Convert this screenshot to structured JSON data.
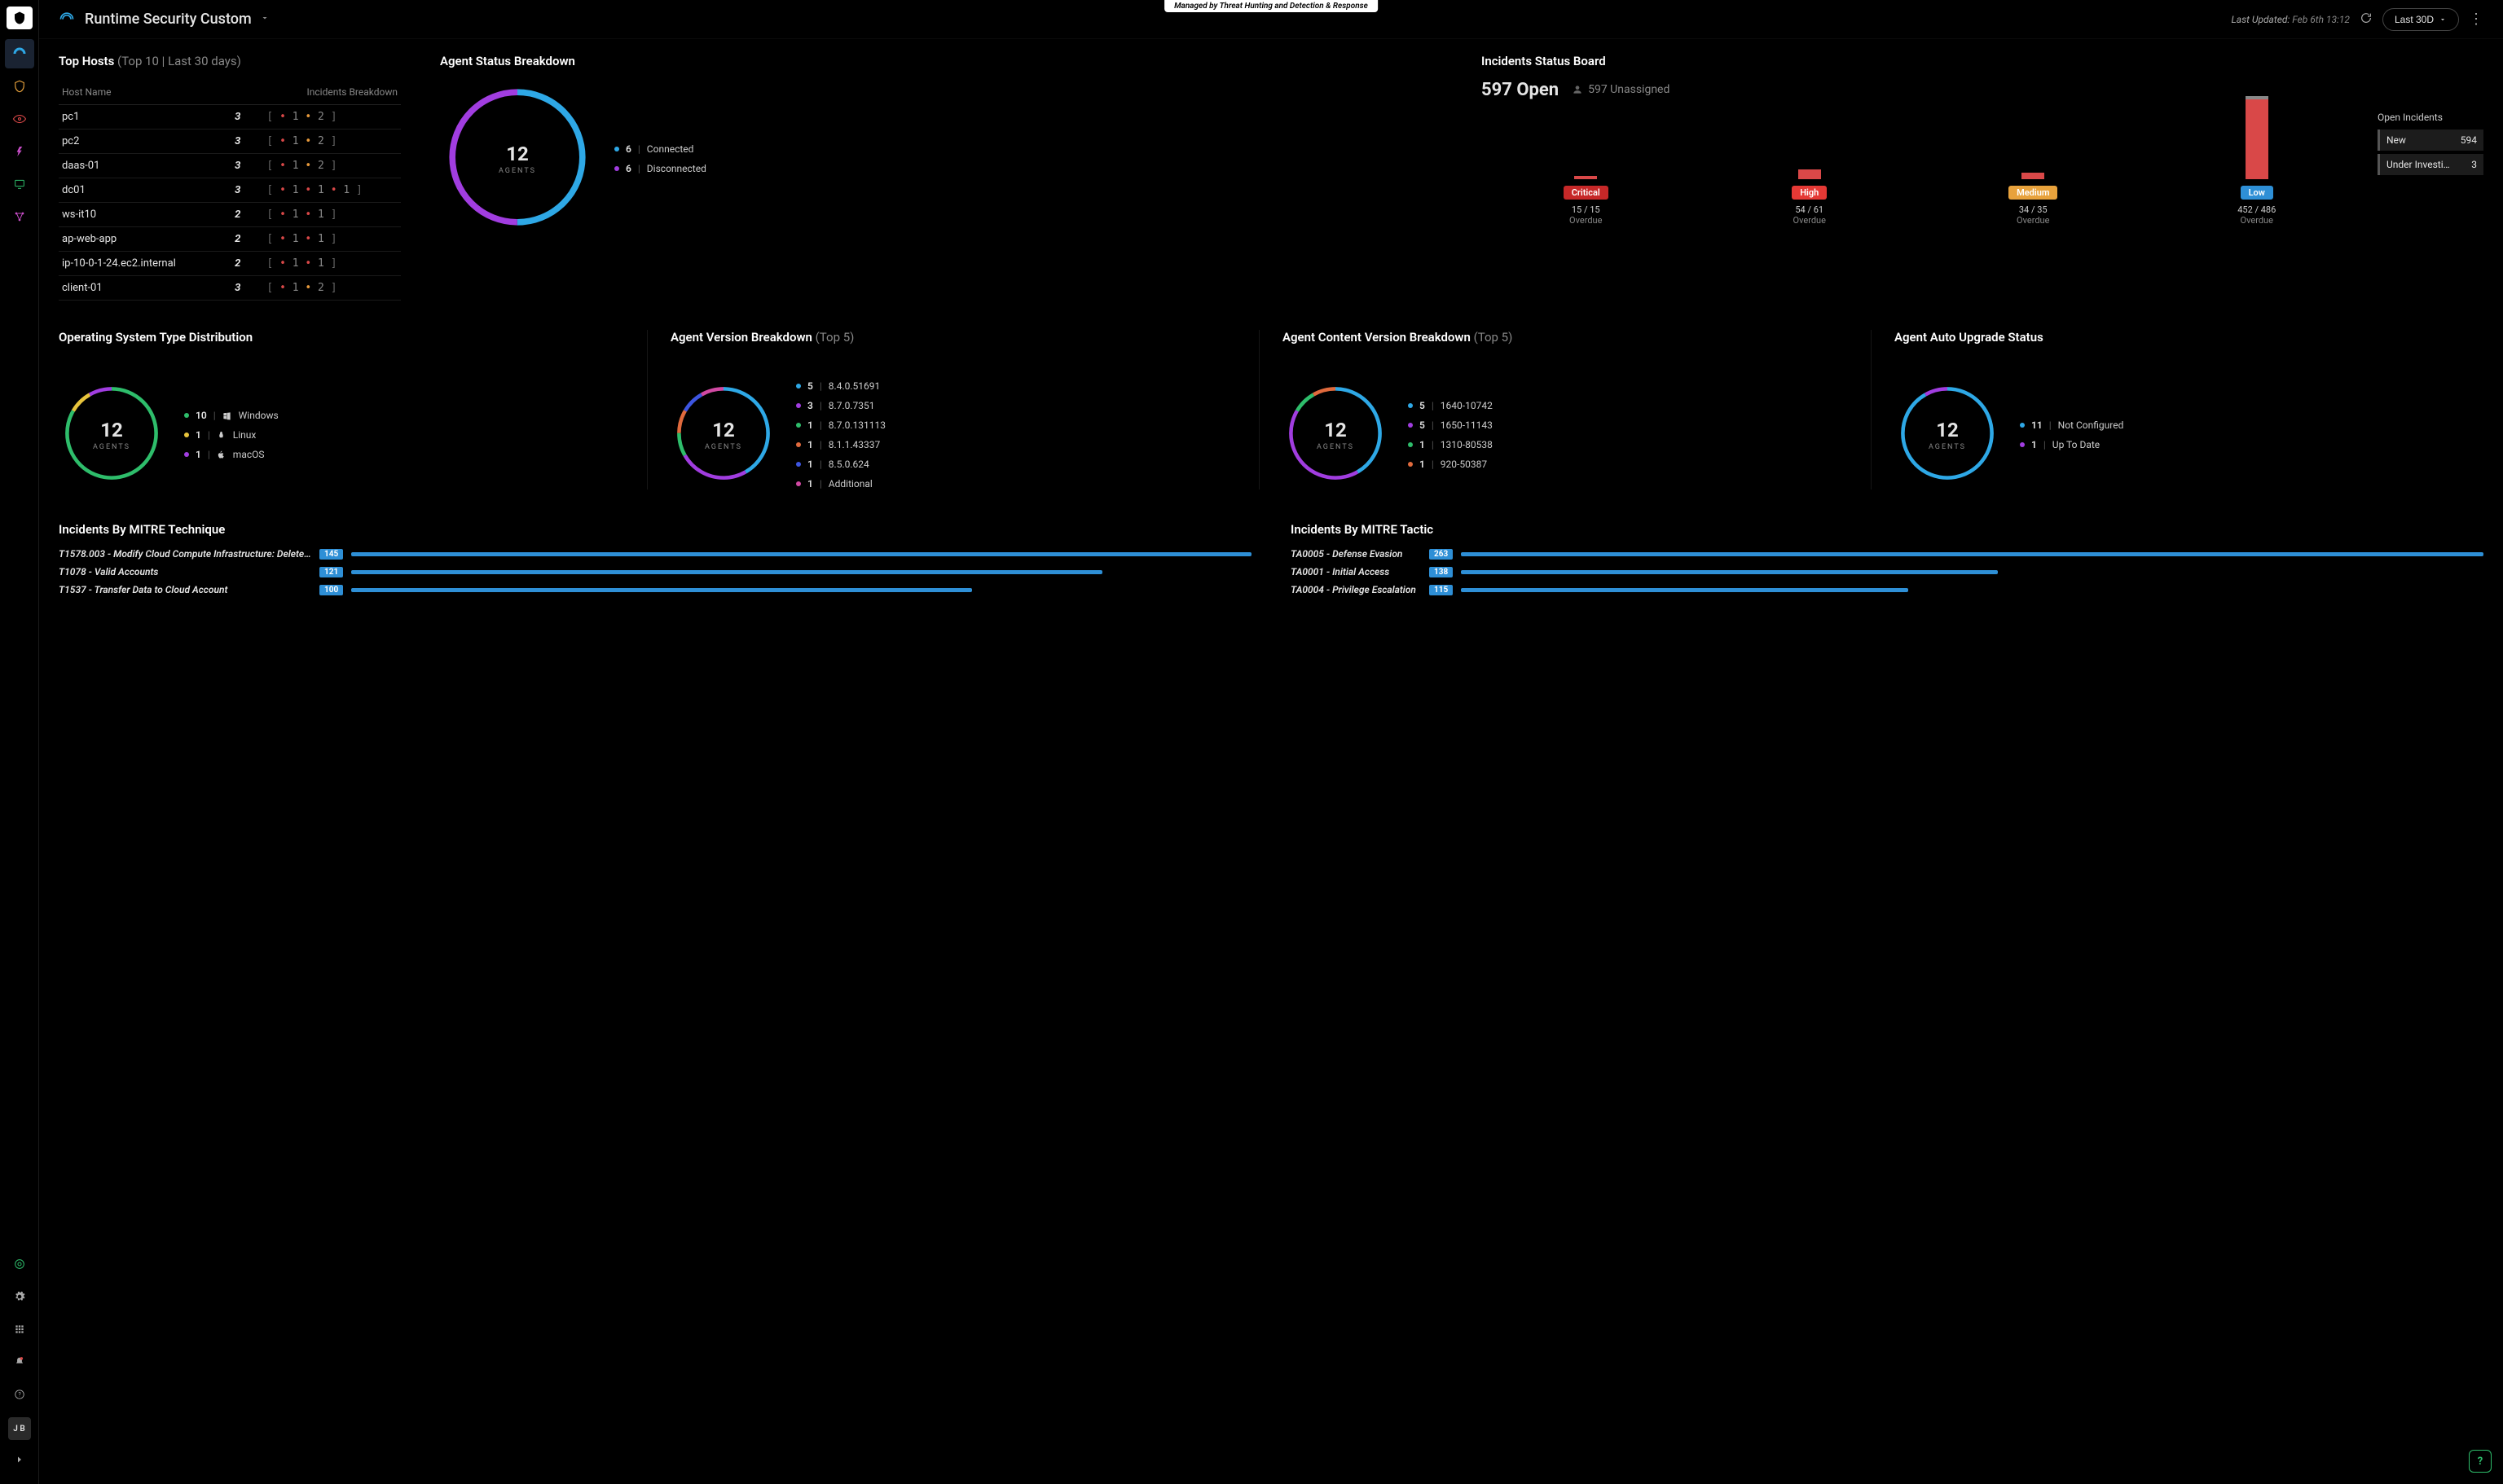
{
  "header": {
    "title": "Runtime Security Custom",
    "managed_banner": "Managed by Threat Hunting and Detection & Response",
    "last_updated_label": "Last Updated:",
    "last_updated_value": "Feb 6th 13:12",
    "time_range": "Last 30D"
  },
  "user_initials": "J B",
  "top_hosts": {
    "title": "Top Hosts",
    "subtitle": "(Top 10 | Last 30 days)",
    "col_host": "Host Name",
    "col_breakdown": "Incidents Breakdown",
    "rows": [
      {
        "host": "pc1",
        "count": "3",
        "bd": [
          [
            "red",
            "1"
          ],
          [
            "orange",
            "2"
          ]
        ]
      },
      {
        "host": "pc2",
        "count": "3",
        "bd": [
          [
            "red",
            "1"
          ],
          [
            "orange",
            "2"
          ]
        ]
      },
      {
        "host": "daas-01",
        "count": "3",
        "bd": [
          [
            "red",
            "1"
          ],
          [
            "orange",
            "2"
          ]
        ]
      },
      {
        "host": "dc01",
        "count": "3",
        "bd": [
          [
            "red",
            "1"
          ],
          [
            "red",
            "1"
          ],
          [
            "red",
            "1"
          ]
        ]
      },
      {
        "host": "ws-it10",
        "count": "2",
        "bd": [
          [
            "red",
            "1"
          ],
          [
            "red",
            "1"
          ]
        ]
      },
      {
        "host": "ap-web-app",
        "count": "2",
        "bd": [
          [
            "red",
            "1"
          ],
          [
            "red",
            "1"
          ]
        ]
      },
      {
        "host": "ip-10-0-1-24.ec2.internal",
        "count": "2",
        "bd": [
          [
            "red",
            "1"
          ],
          [
            "red",
            "1"
          ]
        ]
      },
      {
        "host": "client-01",
        "count": "3",
        "bd": [
          [
            "red",
            "1"
          ],
          [
            "orange",
            "2"
          ]
        ]
      }
    ]
  },
  "agent_status": {
    "title": "Agent Status Breakdown",
    "center_value": "12",
    "center_label": "AGENTS",
    "legend": [
      {
        "color": "#2ea8e6",
        "count": "6",
        "label": "Connected"
      },
      {
        "color": "#a13de0",
        "count": "6",
        "label": "Disconnected"
      }
    ]
  },
  "isb": {
    "title": "Incidents Status Board",
    "open_value": "597 Open",
    "unassigned_value": "597 Unassigned",
    "cols": [
      {
        "label": "Critical",
        "color": "#c62828",
        "height": 4,
        "overdue": "15 / 15"
      },
      {
        "label": "High",
        "color": "#e53935",
        "height": 12,
        "overdue": "54 / 61"
      },
      {
        "label": "Medium",
        "color": "#e8a23c",
        "height": 8,
        "overdue": "34 / 35"
      },
      {
        "label": "Low",
        "color": "#2e8fd6",
        "height": 98,
        "overdue": "452 / 486",
        "cap": 4
      }
    ],
    "overdue_label": "Overdue",
    "side_title": "Open Incidents",
    "side": [
      {
        "label": "New",
        "value": "594"
      },
      {
        "label": "Under Investi…",
        "value": "3"
      }
    ]
  },
  "os_dist": {
    "title": "Operating System Type Distribution",
    "center_value": "12",
    "center_label": "AGENTS",
    "legend": [
      {
        "color": "#2ebd6b",
        "count": "10",
        "icon": "windows",
        "label": "Windows"
      },
      {
        "color": "#e8c43c",
        "count": "1",
        "icon": "linux",
        "label": "Linux"
      },
      {
        "color": "#a13de0",
        "count": "1",
        "icon": "apple",
        "label": "macOS"
      }
    ]
  },
  "agent_version": {
    "title": "Agent Version Breakdown",
    "subtitle": "(Top 5)",
    "center_value": "12",
    "center_label": "AGENTS",
    "legend": [
      {
        "color": "#2ea8e6",
        "count": "5",
        "label": "8.4.0.51691"
      },
      {
        "color": "#a13de0",
        "count": "3",
        "label": "8.7.0.7351"
      },
      {
        "color": "#2ebd6b",
        "count": "1",
        "label": "8.7.0.131113"
      },
      {
        "color": "#e06a3d",
        "count": "1",
        "label": "8.1.1.43337"
      },
      {
        "color": "#3d55e0",
        "count": "1",
        "label": "8.5.0.624"
      },
      {
        "color": "#d149a3",
        "count": "1",
        "label": "Additional"
      }
    ]
  },
  "content_version": {
    "title": "Agent Content Version Breakdown",
    "subtitle": "(Top 5)",
    "center_value": "12",
    "center_label": "AGENTS",
    "legend": [
      {
        "color": "#2ea8e6",
        "count": "5",
        "label": "1640-10742"
      },
      {
        "color": "#a13de0",
        "count": "5",
        "label": "1650-11143"
      },
      {
        "color": "#2ebd6b",
        "count": "1",
        "label": "1310-80538"
      },
      {
        "color": "#e06a3d",
        "count": "1",
        "label": "920-50387"
      }
    ]
  },
  "auto_upgrade": {
    "title": "Agent Auto Upgrade Status",
    "center_value": "12",
    "center_label": "AGENTS",
    "legend": [
      {
        "color": "#2ea8e6",
        "count": "11",
        "label": "Not Configured"
      },
      {
        "color": "#a13de0",
        "count": "1",
        "label": "Up To Date"
      }
    ]
  },
  "mitre_technique": {
    "title": "Incidents By MITRE Technique",
    "max": 145,
    "rows": [
      {
        "label": "T1578.003 - Modify Cloud Compute Infrastructure: Delete Cl…",
        "count": 145
      },
      {
        "label": "T1078 - Valid Accounts",
        "count": 121
      },
      {
        "label": "T1537 - Transfer Data to Cloud Account",
        "count": 100
      }
    ]
  },
  "mitre_tactic": {
    "title": "Incidents By MITRE Tactic",
    "max": 263,
    "rows": [
      {
        "label": "TA0005 - Defense Evasion",
        "count": 263
      },
      {
        "label": "TA0001 - Initial Access",
        "count": 138
      },
      {
        "label": "TA0004 - Privilege Escalation",
        "count": 115
      }
    ]
  },
  "chart_data": [
    {
      "type": "pie",
      "title": "Agent Status Breakdown",
      "categories": [
        "Connected",
        "Disconnected"
      ],
      "values": [
        6,
        6
      ]
    },
    {
      "type": "bar",
      "title": "Incidents Status Board",
      "categories": [
        "Critical",
        "High",
        "Medium",
        "Low"
      ],
      "values": [
        15,
        61,
        35,
        486
      ],
      "overdue": [
        15,
        54,
        34,
        452
      ]
    },
    {
      "type": "pie",
      "title": "Operating System Type Distribution",
      "categories": [
        "Windows",
        "Linux",
        "macOS"
      ],
      "values": [
        10,
        1,
        1
      ]
    },
    {
      "type": "pie",
      "title": "Agent Version Breakdown",
      "categories": [
        "8.4.0.51691",
        "8.7.0.7351",
        "8.7.0.131113",
        "8.1.1.43337",
        "8.5.0.624",
        "Additional"
      ],
      "values": [
        5,
        3,
        1,
        1,
        1,
        1
      ]
    },
    {
      "type": "pie",
      "title": "Agent Content Version Breakdown",
      "categories": [
        "1640-10742",
        "1650-11143",
        "1310-80538",
        "920-50387"
      ],
      "values": [
        5,
        5,
        1,
        1
      ]
    },
    {
      "type": "pie",
      "title": "Agent Auto Upgrade Status",
      "categories": [
        "Not Configured",
        "Up To Date"
      ],
      "values": [
        11,
        1
      ]
    },
    {
      "type": "bar",
      "title": "Incidents By MITRE Technique",
      "categories": [
        "T1578.003",
        "T1078",
        "T1537"
      ],
      "values": [
        145,
        121,
        100
      ]
    },
    {
      "type": "bar",
      "title": "Incidents By MITRE Tactic",
      "categories": [
        "TA0005",
        "TA0001",
        "TA0004"
      ],
      "values": [
        263,
        138,
        115
      ]
    }
  ]
}
